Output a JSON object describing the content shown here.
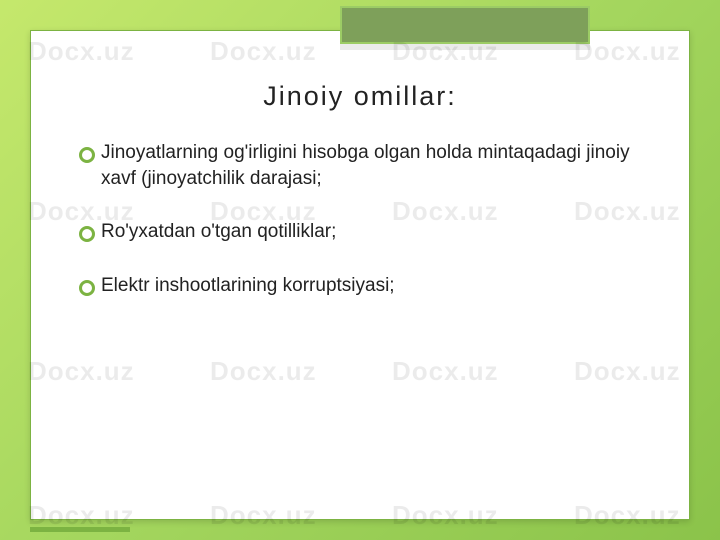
{
  "watermark": "Docx.uz",
  "slide": {
    "title": "Jinoiy omillar:",
    "bullets": [
      "Jinoyatlarning og'irligini hisobga olgan holda mintaqadagi jinoiy xavf (jinoyatchilik darajasi;",
      "Ro'yxatdan o'tgan qotilliklar;",
      "Elektr inshootlarining korruptsiyasi;"
    ]
  }
}
